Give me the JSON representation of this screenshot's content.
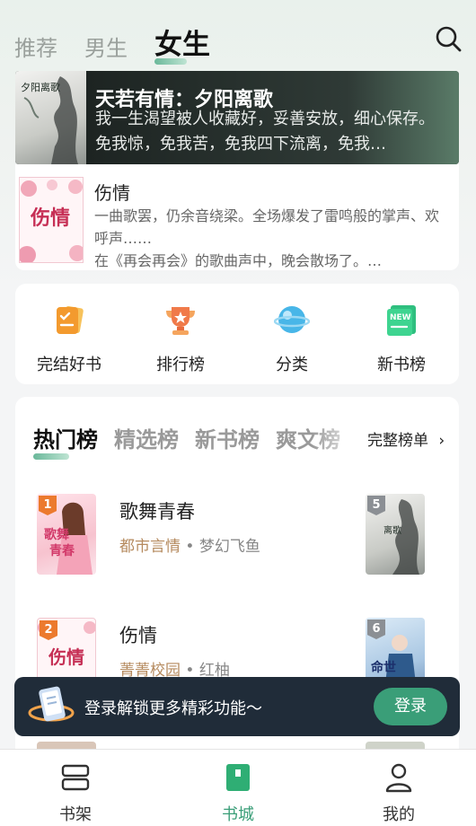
{
  "header": {
    "tabs": [
      {
        "label": "推荐"
      },
      {
        "label": "男生"
      },
      {
        "label": "女生"
      }
    ],
    "active_tab": "女生",
    "search_icon": "search-icon"
  },
  "hero": {
    "title": "天若有情：夕阳离歌",
    "description": "我一生渴望被人收藏好，妥善安放，细心保存。免我惊，免我苦，免我四下流离，免我…",
    "cover_text": "夕阳离歌"
  },
  "featured": {
    "title": "伤情",
    "description_line1": "一曲歌罢，仍余音绕梁。全场爆发了雷鸣般的掌声、欢呼声……",
    "description_line2": "在《再会再会》的歌曲声中，晚会散场了。…",
    "cover_text": "伤情"
  },
  "quick_entries": [
    {
      "label": "完结好书",
      "icon": "finished-books-icon"
    },
    {
      "label": "排行榜",
      "icon": "trophy-icon"
    },
    {
      "label": "分类",
      "icon": "category-planet-icon"
    },
    {
      "label": "新书榜",
      "icon": "new-book-icon"
    }
  ],
  "rank": {
    "tabs": [
      "热门榜",
      "精选榜",
      "新书榜",
      "爽文榜"
    ],
    "full_list_label": "完整榜单",
    "books": [
      {
        "num": "1",
        "title": "歌舞青春",
        "category": "都市言情",
        "author": "梦幻飞鱼",
        "cover_text": "歌舞青春"
      },
      {
        "num": "2",
        "title": "伤情",
        "category": "菁菁校园",
        "author": "红柚",
        "cover_text": "伤情"
      }
    ],
    "right_covers": [
      {
        "num": "5",
        "cover_text": "夕阳离歌"
      },
      {
        "num": "6",
        "cover_text": "命世"
      }
    ]
  },
  "login_banner": {
    "text": "登录解锁更多精彩功能～",
    "button": "登录"
  },
  "bottom_nav": [
    {
      "label": "书架",
      "icon": "bookshelf-icon"
    },
    {
      "label": "书城",
      "icon": "bookstore-icon"
    },
    {
      "label": "我的",
      "icon": "profile-icon"
    }
  ],
  "colors": {
    "accent": "#3a9e78",
    "banner_bg": "#202c39",
    "rank_badge": "#ec7a2e"
  }
}
